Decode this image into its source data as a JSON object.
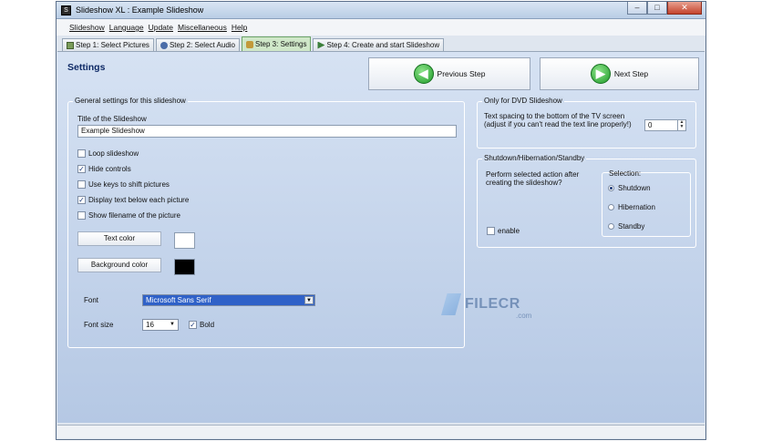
{
  "window": {
    "title": "Slideshow XL : Example Slideshow",
    "app_icon_glyph": "S",
    "controls": {
      "minimize": "–",
      "maximize": "□",
      "close": "✕"
    }
  },
  "menu": [
    "Slideshow",
    "Language",
    "Update",
    "Miscellaneous",
    "Help"
  ],
  "tabs": [
    {
      "label": "Step 1: Select Pictures",
      "icon": "picture-icon"
    },
    {
      "label": "Step 2: Select Audio",
      "icon": "audio-icon"
    },
    {
      "label": "Step 3: Settings",
      "icon": "settings-icon",
      "active": true
    },
    {
      "label": "Step 4: Create and start Slideshow",
      "icon": "play-icon"
    }
  ],
  "page": {
    "title": "Settings",
    "prev_button": "Previous Step",
    "prev_glyph": "◀",
    "next_button": "Next Step",
    "next_glyph": "▶"
  },
  "general": {
    "group_label": "General settings for this slideshow",
    "title_label": "Title of the Slideshow",
    "title_value": "Example Slideshow",
    "options": [
      {
        "label": "Loop slideshow",
        "checked": false
      },
      {
        "label": "Hide controls",
        "checked": true
      },
      {
        "label": "Use keys to shift pictures",
        "checked": false
      },
      {
        "label": "Display text below each picture",
        "checked": true
      },
      {
        "label": "Show filename of the picture",
        "checked": false
      }
    ],
    "text_color_button": "Text color",
    "text_color": "#ffffff",
    "background_color_button": "Background color",
    "background_color": "#000000",
    "font_label": "Font",
    "font_value": "Microsoft Sans Serif",
    "font_size_label": "Font size",
    "font_size_value": "16",
    "bold_label": "Bold",
    "bold_checked": true
  },
  "dvd": {
    "group_label": "Only for DVD Slideshow",
    "description_line1": "Text spacing to the bottom of the TV screen",
    "description_line2": "(adjust if you can't read the text line properly!)",
    "spacing_value": "0"
  },
  "shutdown": {
    "group_label": "Shutdown/Hibernation/Standby",
    "description_line1": "Perform selected action after",
    "description_line2": "creating the slideshow?",
    "enable_label": "enable",
    "enable_checked": false,
    "selection_label": "Selection:",
    "options": [
      {
        "label": "Shutdown",
        "selected": true
      },
      {
        "label": "Hibernation",
        "selected": false
      },
      {
        "label": "Standby",
        "selected": false
      }
    ]
  },
  "watermark": {
    "text": "FILECR",
    "sub": ".com"
  },
  "colors": {
    "accent": "#0f2a66",
    "selection": "#2f61c8",
    "active_tab": "#cfe7c8"
  },
  "glyphs": {
    "check": "✓",
    "dropdown": "▼",
    "spin_up": "▲",
    "spin_down": "▼"
  }
}
